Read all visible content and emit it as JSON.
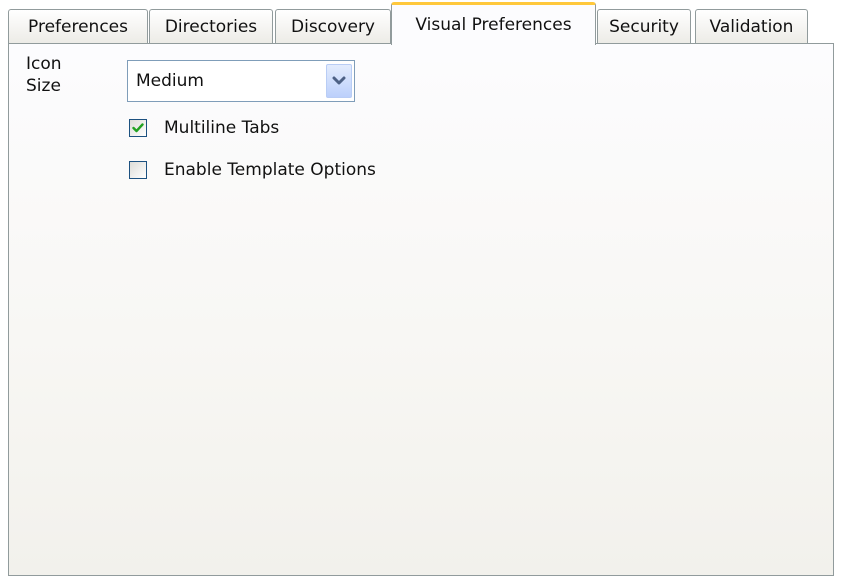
{
  "tabs": [
    {
      "label": "Preferences",
      "active": false
    },
    {
      "label": "Directories",
      "active": false
    },
    {
      "label": "Discovery",
      "active": false
    },
    {
      "label": "Visual Preferences",
      "active": true
    },
    {
      "label": "Security",
      "active": false
    },
    {
      "label": "Validation",
      "active": false
    }
  ],
  "icon_size": {
    "label": "Icon Size",
    "selected": "Medium",
    "dropdown_icon": "chevron-down-icon"
  },
  "options": [
    {
      "label": "Multiline Tabs",
      "checked": true
    },
    {
      "label": "Enable Template Options",
      "checked": false
    }
  ],
  "colors": {
    "active_tab_accent": "#ffc83c",
    "checkmark": "#21a121",
    "dropdown_chevron": "#4d6185"
  }
}
